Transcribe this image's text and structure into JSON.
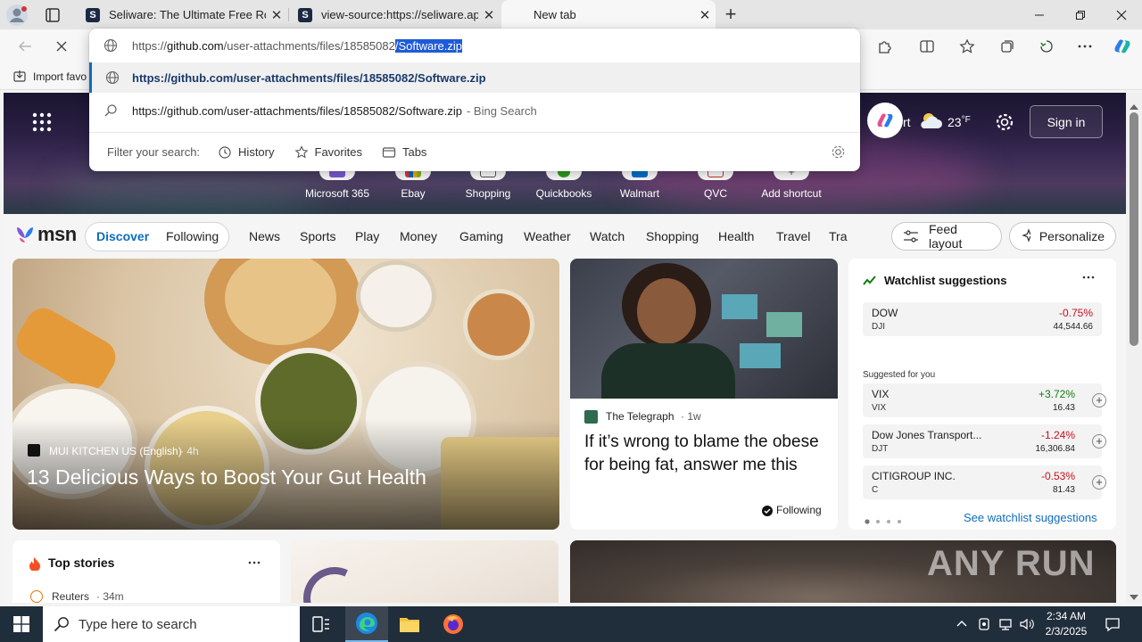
{
  "browser": {
    "tabs": [
      {
        "title": "Seliware: The Ultimate Free Roblox",
        "favicon_letter": "S"
      },
      {
        "title": "view-source:https://seliware.app",
        "favicon_letter": "S"
      },
      {
        "title": "New tab"
      }
    ],
    "address": {
      "url_prefix": "https://",
      "url_host": "github.com",
      "url_path": "/user-attachments/files/18585082",
      "url_selected": "/Software.zip"
    },
    "favorites_bar": {
      "import_label": "Import favo"
    }
  },
  "omnibox": {
    "suggestion_1": "https://github.com/user-attachments/files/18585082/Software.zip",
    "suggestion_2_query": "https://github.com/user-attachments/files/18585082/Software.zip",
    "suggestion_2_engine": "- Bing Search",
    "filter_label": "Filter your search:",
    "filters": [
      "History",
      "Favorites",
      "Tabs"
    ]
  },
  "hero": {
    "location_fragment": "rt",
    "temperature": "23",
    "temp_unit": "°F",
    "sign_in": "Sign in",
    "shortcuts": [
      {
        "label": "Microsoft 365",
        "color": "#7b5bd6"
      },
      {
        "label": "Ebay",
        "color": "#e53238"
      },
      {
        "label": "Shopping",
        "color": "#555555"
      },
      {
        "label": "Quickbooks",
        "color": "#2ca01c"
      },
      {
        "label": "Walmart",
        "color": "#0071ce"
      },
      {
        "label": "QVC",
        "color": "#c0392b"
      },
      {
        "label": "Add shortcut",
        "color": "#888888"
      }
    ]
  },
  "msn": {
    "logo_text": "msn",
    "discover": "Discover",
    "following": "Following",
    "nav": [
      "News",
      "Sports",
      "Play",
      "Money",
      "Gaming",
      "Weather",
      "Watch",
      "Shopping",
      "Health",
      "Travel",
      "Tra"
    ],
    "feed_layout": "Feed layout",
    "personalize": "Personalize"
  },
  "cards": {
    "main": {
      "source": "MUI KITCHEN US (English)",
      "age": "· 4h",
      "headline": "13 Delicious Ways to Boost Your Gut Health"
    },
    "side": {
      "source": "The Telegraph",
      "age": "· 1w",
      "headline": "If it’s wrong to blame the obese for being fat, answer me this",
      "follow_label": "Following"
    },
    "top_stories": {
      "title": "Top stories",
      "first_source": "Reuters",
      "first_age": "· 34m"
    }
  },
  "watchlist": {
    "title": "Watchlist suggestions",
    "main": {
      "name": "DOW",
      "symbol": "DJI",
      "change": "-0.75%",
      "price": "44,544.66"
    },
    "suggested_label": "Suggested for you",
    "suggested": [
      {
        "name": "VIX",
        "symbol": "VIX",
        "change": "+3.72%",
        "price": "16.43"
      },
      {
        "name": "Dow Jones Transport...",
        "symbol": "DJT",
        "change": "-1.24%",
        "price": "16,306.84"
      },
      {
        "name": "CITIGROUP INC.",
        "symbol": "C",
        "change": "-0.53%",
        "price": "81.43"
      }
    ],
    "see_more": "See watchlist suggestions"
  },
  "watermark": "ANY RUN",
  "taskbar": {
    "search_placeholder": "Type here to search",
    "time": "2:34 AM",
    "date": "2/3/2025"
  },
  "colors": {
    "accent": "#0f6cbd",
    "negative": "#c50f1f",
    "positive": "#107c10",
    "selection": "#1e5bd8",
    "taskbar": "#202d3b"
  }
}
